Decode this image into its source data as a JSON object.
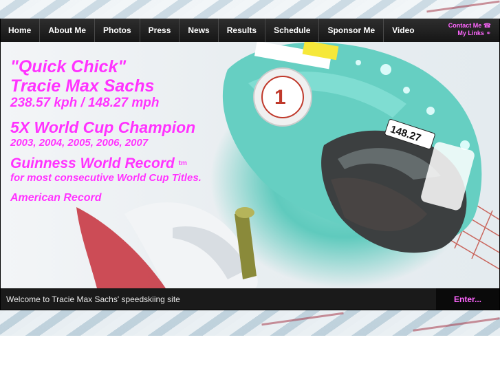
{
  "nav": {
    "items": [
      "Home",
      "About Me",
      "Photos",
      "Press",
      "News",
      "Results",
      "Schedule",
      "Sponsor Me",
      "Video"
    ],
    "contact_label": "Contact Me",
    "links_label": "My Links"
  },
  "hero": {
    "nickname": "\"Quick Chick\"",
    "name": "Tracie Max Sachs",
    "speed": "238.57 kph / 148.27 mph",
    "title_champion": "5X World Cup Champion",
    "years": "2003, 2004, 2005, 2006, 2007",
    "record_title": "Guinness World Record",
    "tm": "tm",
    "record_detail": "for most consecutive World Cup Titles.",
    "american_record": "American Record"
  },
  "photo": {
    "bib_number": "148.27"
  },
  "footer": {
    "welcome": "Welcome to Tracie Max Sachs' speedskiing site",
    "enter_label": "Enter..."
  },
  "colors": {
    "accent": "#ff33ff",
    "nav_bg": "#1e1e1e",
    "helmet": "#66cfc2"
  }
}
